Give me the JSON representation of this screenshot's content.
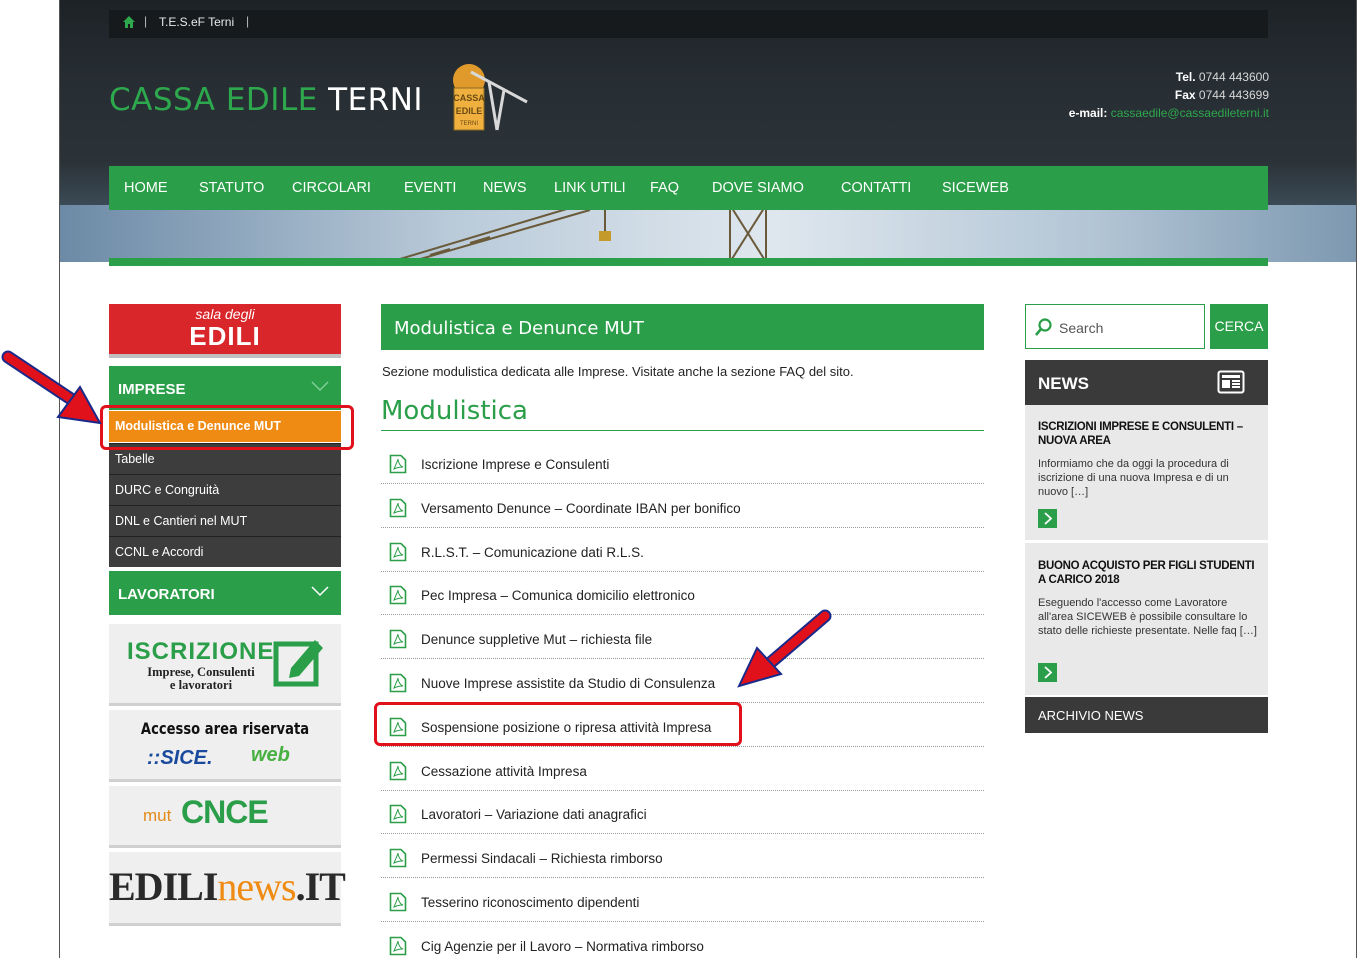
{
  "topbar": {
    "link": "T.E.S.eF Terni",
    "separator": "|"
  },
  "header": {
    "logo_part1": "CASSA EDILE ",
    "logo_part2": "TERNI",
    "contact": {
      "tel_label": "Tel.",
      "tel": "0744 443600",
      "fax_label": "Fax",
      "fax": "0744 443699",
      "email_label": "e-mail:",
      "email": "cassaedile@cassaedileterni.it"
    }
  },
  "nav": [
    "HOME",
    "STATUTO",
    "CIRCOLARI",
    "EVENTI",
    "NEWS",
    "LINK UTILI",
    "FAQ",
    "DOVE SIAMO",
    "CONTATTI",
    "SICEWEB"
  ],
  "sidebar": {
    "sala_small": "sala degli",
    "sala_big": "EDILI",
    "imprese_label": "IMPRESE",
    "active_item": "Modulistica e Denunce MUT",
    "items": [
      "Tabelle",
      "DURC e Congruità",
      "DNL e Cantieri nel MUT",
      "CCNL e Accordi"
    ],
    "lavoratori_label": "LAVORATORI",
    "banner_iscrizione": {
      "title": "ISCRIZIONE",
      "line1": "Imprese, Consulenti",
      "line2": "e lavoratori"
    },
    "banner_sice": {
      "line1": "Accesso area riservata",
      "logo1": "::SICE.",
      "logo2": "web"
    },
    "banner_mut": {
      "prefix": "mut",
      "logo": "CNCE"
    },
    "banner_edilinews": {
      "part1": "EDILI",
      "part2": "news",
      "part3": ".IT"
    }
  },
  "main": {
    "title": "Modulistica e Denunce MUT",
    "intro": "Sezione modulistica dedicata alle Imprese. Visitate anche la sezione FAQ del sito.",
    "section": "Modulistica",
    "documents": [
      "Iscrizione Imprese e Consulenti",
      "Versamento Denunce – Coordinate IBAN per bonifico",
      "R.L.S.T. – Comunicazione dati R.L.S.",
      "Pec Impresa – Comunica domicilio elettronico",
      "Denunce suppletive Mut – richiesta file",
      "Nuove Imprese assistite da Studio di Consulenza",
      "Sospensione posizione o ripresa attività Impresa",
      "Cessazione attività Impresa",
      "Lavoratori – Variazione dati anagrafici",
      "Permessi Sindacali – Richiesta rimborso",
      "Tesserino riconoscimento dipendenti",
      "Cig Agenzie per il Lavoro – Normativa rimborso"
    ]
  },
  "right": {
    "search_placeholder": "Search",
    "search_button": "CERCA",
    "news_title": "NEWS",
    "news": [
      {
        "title": "ISCRIZIONI IMPRESE E CONSULENTI – NUOVA AREA",
        "text": "Informiamo che da oggi la procedura di iscrizione di una nuova Impresa e di un nuovo […]"
      },
      {
        "title": "BUONO ACQUISTO PER FIGLI STUDENTI A CARICO 2018",
        "text": "Eseguendo l'accesso come Lavoratore all'area SICEWEB è possibile consultare lo stato delle richieste presentate. Nelle faq […]"
      }
    ],
    "archive": "ARCHIVIO NEWS"
  },
  "colors": {
    "brand_green": "#2a9e48",
    "active_orange": "#ef8a12",
    "annotation_red": "#e0111a",
    "dark": "#3d3d3d"
  },
  "icons": [
    "home-icon",
    "pdf-icon",
    "search-icon",
    "newspaper-icon",
    "chevron-down-icon",
    "chevron-right-icon"
  ]
}
